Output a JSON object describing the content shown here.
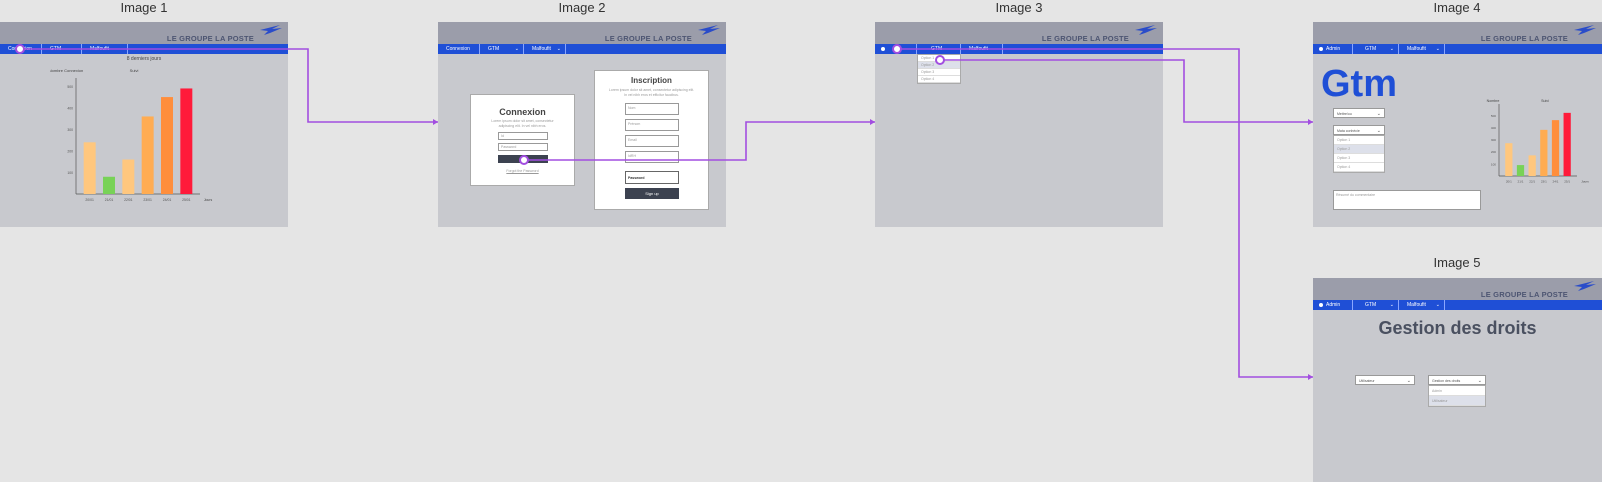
{
  "frames": [
    {
      "title": "Image 1"
    },
    {
      "title": "Image 2"
    },
    {
      "title": "Image 3"
    },
    {
      "title": "Image 4"
    },
    {
      "title": "Image 5"
    }
  ],
  "brand": "LE GROUPE LA POSTE",
  "nav": {
    "connexion": "Connexion",
    "gtm": "GTM",
    "gtm_lower": "Gtm",
    "malfait": "Malfoufit",
    "admin": "Admin"
  },
  "image1": {
    "chart_title": "8 derniers jours",
    "chart_data": {
      "type": "bar",
      "title": "8 derniers jours",
      "ylabel": "Nombre Connexion",
      "subtitle": "Suivi",
      "xlabel": "Jours",
      "categories": [
        "20/01",
        "21/01",
        "22/01",
        "23/01",
        "24/01",
        "25/01"
      ],
      "values": [
        240,
        80,
        160,
        360,
        450,
        490
      ],
      "colors": [
        "#ffc77e",
        "#78d257",
        "#ffc77e",
        "#ffac52",
        "#ff8e3c",
        "#ff1a3a"
      ],
      "y_ticks": [
        100,
        200,
        300,
        400,
        500
      ],
      "ylim": [
        0,
        520
      ]
    }
  },
  "image2": {
    "login_title": "Connexion",
    "login_text": [
      "Lorem ipsum dolor sit amet, consectetur",
      "adipiscing elit. In vel nibh eros."
    ],
    "id_placeholder": "Id",
    "password_placeholder": "Password",
    "forgot": "Forgot the Password",
    "signup_title": "Inscription",
    "signup_text": [
      "Lorem ipsum dolor sit amet, consectetur adipiscing elit.",
      "In vel nibh eros et efficitur faucibus."
    ],
    "nom": "Nom",
    "prenom": "Prénom",
    "email": "Email",
    "idrh": "IdRH",
    "password": "Password",
    "signup_button": "Sign up"
  },
  "image3": {
    "options": [
      "Option 1",
      "Option 2",
      "Option 3",
      "Option 4"
    ]
  },
  "image4": {
    "heading": "Gtm",
    "select1": "Mettre/ou",
    "select2": "Mata conhécie",
    "options": [
      "Option 1",
      "Option 2",
      "Option 3",
      "Option 4"
    ],
    "comment_placeholder": "Résumé du commentaire",
    "chart_data": {
      "type": "bar",
      "ylabel": "Nombre",
      "subtitle": "Suivi",
      "xlabel": "Jours",
      "categories": [
        "20/1",
        "21/1",
        "22/1",
        "23/1",
        "24/1",
        "25/1"
      ],
      "values": [
        270,
        90,
        170,
        380,
        460,
        520
      ],
      "colors": [
        "#ffc77e",
        "#78d257",
        "#ffc77e",
        "#ffac52",
        "#ff8e3c",
        "#ff1a3a"
      ],
      "y_ticks": [
        100,
        200,
        300,
        400,
        500
      ],
      "ylim": [
        0,
        560
      ]
    }
  },
  "image5": {
    "heading": "Gestion des droits",
    "user_select": "Utilisateur",
    "rights_select": "Gestion des droits",
    "options": [
      "Admin",
      "Utilisateur"
    ]
  },
  "connector_color": "#a24ee0"
}
